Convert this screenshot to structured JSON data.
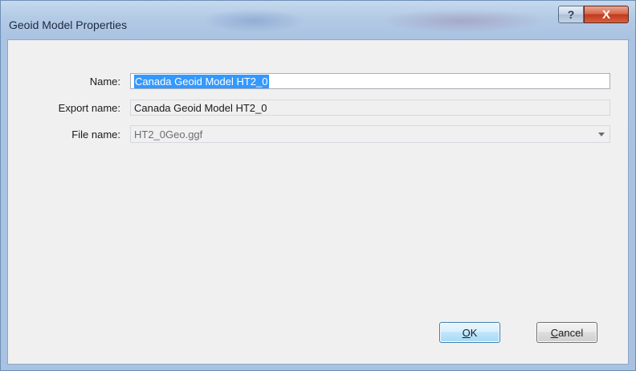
{
  "window": {
    "title": "Geoid Model Properties",
    "help_glyph": "?",
    "close_glyph": "X"
  },
  "form": {
    "name_label": "Name:",
    "name_value": "Canada Geoid Model HT2_0",
    "export_name_label": "Export name:",
    "export_name_value": "Canada Geoid Model HT2_0",
    "file_name_label": "File name:",
    "file_name_value": "HT2_0Geo.ggf"
  },
  "buttons": {
    "ok_mnemonic": "O",
    "ok_rest": "K",
    "cancel_mnemonic": "C",
    "cancel_rest": "ancel"
  },
  "colors": {
    "selection": "#3399ff",
    "close_button": "#c2391c",
    "dialog_background": "#f0f0f0"
  }
}
